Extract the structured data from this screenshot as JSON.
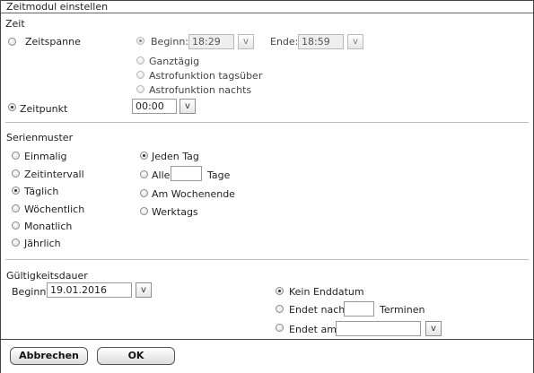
{
  "window": {
    "title": "Zeitmodul einstellen"
  },
  "zeit": {
    "section_label": "Zeit",
    "zeitspanne_label": "Zeitspanne",
    "beginn_label": "Beginn:",
    "beginn_value": "18:29",
    "ende_label": "Ende:",
    "ende_value": "18:59",
    "dropdown_glyph": "v",
    "ganztaegig_label": "Ganztägig",
    "astro_tag_label": "Astrofunktion tagsüber",
    "astro_nacht_label": "Astrofunktion nachts",
    "zeitpunkt_label": "Zeitpunkt",
    "zeitpunkt_value": "00:00"
  },
  "serienmuster": {
    "section_label": "Serienmuster",
    "options": [
      {
        "label": "Einmalig",
        "selected": false
      },
      {
        "label": "Zeitintervall",
        "selected": false
      },
      {
        "label": "Täglich",
        "selected": true
      },
      {
        "label": "Wöchentlich",
        "selected": false
      },
      {
        "label": "Monatlich",
        "selected": false
      },
      {
        "label": "Jährlich",
        "selected": false
      }
    ],
    "daily_options": {
      "jeden_tag_label": "Jeden Tag",
      "alle_label": "Alle",
      "alle_value": "",
      "tage_label": "Tage",
      "wochenende_label": "Am Wochenende",
      "werktags_label": "Werktags"
    }
  },
  "gueltigkeit": {
    "section_label": "Gültigkeitsdauer",
    "beginn_label": "Beginn",
    "beginn_value": "19.01.2016",
    "dropdown_glyph": "v",
    "kein_enddatum_label": "Kein Enddatum",
    "endet_nach_label": "Endet nach",
    "endet_nach_value": "",
    "terminen_label": "Terminen",
    "endet_am_label": "Endet am",
    "endet_am_value": ""
  },
  "footer": {
    "cancel_label": "Abbrechen",
    "ok_label": "OK"
  }
}
